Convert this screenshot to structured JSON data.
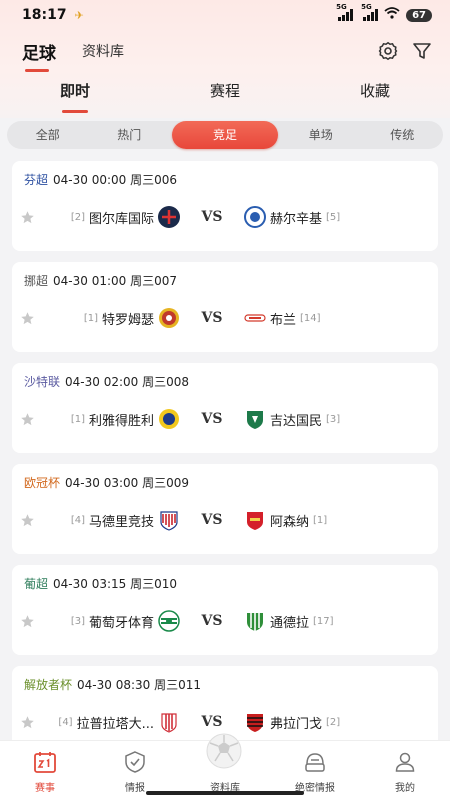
{
  "status_bar": {
    "time": "18:17",
    "battery": "67",
    "network1": "5G",
    "network2": "5G"
  },
  "header": {
    "tab_football": "足球",
    "tab_database": "资料库"
  },
  "subtabs": [
    "即时",
    "赛程",
    "收藏"
  ],
  "filters": [
    "全部",
    "热门",
    "竞足",
    "单场",
    "传统"
  ],
  "matches": [
    {
      "league": "芬超",
      "league_color": "#2c4fa0",
      "info": "04-30 00:00  周三006",
      "home_rank": "[2]",
      "home": "图尔库国际",
      "away": "赫尔辛基",
      "away_rank": "[5]",
      "vs": "VS",
      "home_color": "#1b2a4a",
      "away_color": "#2a5db0"
    },
    {
      "league": "挪超",
      "league_color": "#555555",
      "info": "04-30 01:00  周三007",
      "home_rank": "[1]",
      "home": "特罗姆瑟",
      "away": "布兰",
      "away_rank": "[14]",
      "vs": "VS",
      "home_color": "#c0392b",
      "away_color": "#d33a2c"
    },
    {
      "league": "沙特联",
      "league_color": "#5a5aa0",
      "info": "04-30 02:00  周三008",
      "home_rank": "[1]",
      "home": "利雅得胜利",
      "away": "吉达国民",
      "away_rank": "[3]",
      "vs": "VS",
      "home_color": "#e8c21a",
      "away_color": "#1d7a4a"
    },
    {
      "league": "欧冠杯",
      "league_color": "#d2691e",
      "info": "04-30 03:00  周三009",
      "home_rank": "[4]",
      "home": "马德里竞技",
      "away": "阿森纳",
      "away_rank": "[1]",
      "vs": "VS",
      "home_color": "#c8262e",
      "away_color": "#d4202a"
    },
    {
      "league": "葡超",
      "league_color": "#2e7d5b",
      "info": "04-30 03:15  周三010",
      "home_rank": "[3]",
      "home": "葡萄牙体育",
      "away": "通德拉",
      "away_rank": "[17]",
      "vs": "VS",
      "home_color": "#1a8a4a",
      "away_color": "#2f8f3a"
    },
    {
      "league": "解放者杯",
      "league_color": "#6a8f2a",
      "info": "04-30 08:30  周三011",
      "home_rank": "[4]",
      "home": "拉普拉塔大...",
      "away": "弗拉门戈",
      "away_rank": "[2]",
      "vs": "VS",
      "home_color": "#d0303a",
      "away_color": "#c81e1e"
    }
  ],
  "bottom_nav": [
    {
      "label": "赛事",
      "icon": "calendar-icon",
      "active": true
    },
    {
      "label": "情报",
      "icon": "shield-check-icon",
      "active": false
    },
    {
      "label": "资料库",
      "icon": "soccer-ball-icon",
      "active": false
    },
    {
      "label": "绝密情报",
      "icon": "secret-box-icon",
      "active": false
    },
    {
      "label": "我的",
      "icon": "user-icon",
      "active": false
    }
  ],
  "accent_color": "#e24a3b"
}
